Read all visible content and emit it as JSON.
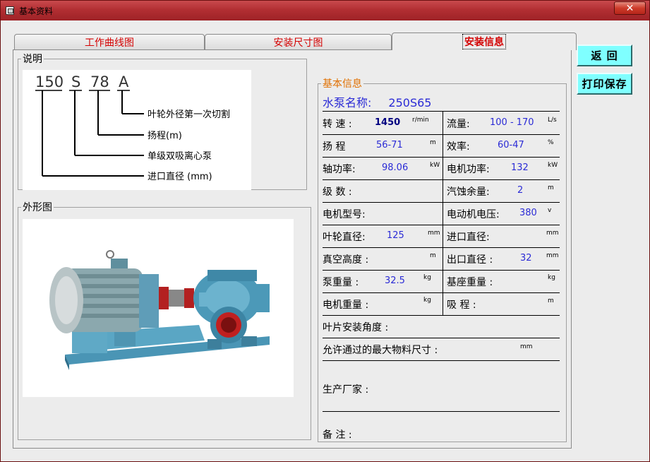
{
  "window": {
    "title": "基本资料",
    "close_label": "✕"
  },
  "tabs": [
    {
      "label": "工作曲线图"
    },
    {
      "label": "安装尺寸图"
    },
    {
      "label": "安装信息"
    }
  ],
  "explanation": {
    "legend": "说明",
    "model_parts": [
      "150",
      "S",
      "78",
      "A"
    ],
    "callouts": [
      "叶轮外径第一次切割",
      "扬程(m)",
      "单级双吸离心泵",
      "进口直径 (mm)"
    ]
  },
  "appearance": {
    "legend": "外形图"
  },
  "basic_info": {
    "legend": "基本信息",
    "pump_name_label": "水泵名称:",
    "pump_name_value": "250S65",
    "rows": {
      "speed": {
        "label": "转 速 :",
        "value": "1450",
        "unit": "r/min"
      },
      "flow": {
        "label": "流量:",
        "value": "100 - 170",
        "unit": "L/s"
      },
      "head": {
        "label": "扬 程",
        "value": "56-71",
        "unit": "m"
      },
      "efficiency": {
        "label": "效率:",
        "value": "60-47",
        "unit": "%"
      },
      "shaft_power": {
        "label": "轴功率:",
        "value": "98.06",
        "unit": "kW"
      },
      "motor_power": {
        "label": "电机功率:",
        "value": "132",
        "unit": "kW"
      },
      "stages": {
        "label": "级 数 :",
        "value": "",
        "unit": ""
      },
      "npsh": {
        "label": "汽蚀余量:",
        "value": "2",
        "unit": "m"
      },
      "motor_model": {
        "label": "电机型号:",
        "value": "",
        "unit": ""
      },
      "motor_voltage": {
        "label": "电动机电压:",
        "value": "380",
        "unit": "v"
      },
      "impeller_dia": {
        "label": "叶轮直径:",
        "value": "125",
        "unit": "mm"
      },
      "inlet_dia": {
        "label": "进口直径:",
        "value": "",
        "unit": "mm"
      },
      "vacuum_height": {
        "label": "真空高度 :",
        "value": "",
        "unit": "m"
      },
      "outlet_dia": {
        "label": "出口直径 :",
        "value": "32",
        "unit": "mm"
      },
      "pump_weight": {
        "label": "泵重量 :",
        "value": "32.5",
        "unit": "kg"
      },
      "base_weight": {
        "label": "基座重量 :",
        "value": "",
        "unit": "kg"
      },
      "motor_weight": {
        "label": "电机重量 :",
        "value": "",
        "unit": "kg"
      },
      "suction_lift": {
        "label": "吸 程 :",
        "value": "",
        "unit": "m"
      },
      "blade_angle": {
        "label": "叶片安装角度 :"
      },
      "max_particle": {
        "label": "允许通过的最大物料尺寸 :",
        "unit": "mm"
      },
      "manufacturer": {
        "label": "生产厂家 :"
      },
      "remarks": {
        "label": "备 注 :"
      }
    }
  },
  "buttons": {
    "back": "返 回",
    "print_save": "打印保存"
  }
}
